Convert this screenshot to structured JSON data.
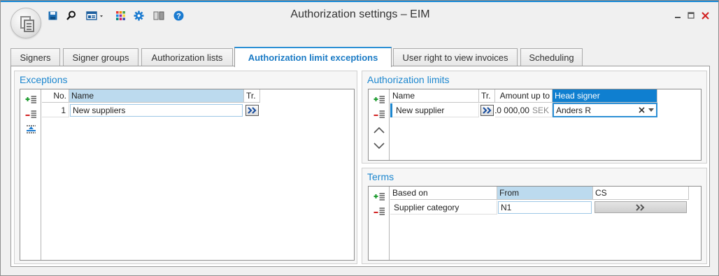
{
  "window": {
    "title": "Authorization settings – EIM"
  },
  "quick_access": {
    "icons": [
      "save-icon",
      "search-icon",
      "layout-icon",
      "grid-apps-icon",
      "gear-icon",
      "book-icon",
      "help-icon"
    ]
  },
  "tabs": [
    {
      "label": "Signers",
      "active": false
    },
    {
      "label": "Signer groups",
      "active": false
    },
    {
      "label": "Authorization lists",
      "active": false
    },
    {
      "label": "Authorization limit exceptions",
      "active": true
    },
    {
      "label": "User right to view invoices",
      "active": false
    },
    {
      "label": "Scheduling",
      "active": false
    }
  ],
  "exceptions": {
    "title": "Exceptions",
    "columns": {
      "no": "No.",
      "name": "Name",
      "tr": "Tr."
    },
    "rows": [
      {
        "no": "1",
        "name": "New suppliers"
      }
    ]
  },
  "authorization_limits": {
    "title": "Authorization limits",
    "columns": {
      "name": "Name",
      "tr": "Tr.",
      "amount": "Amount up to",
      "head_signer": "Head signer"
    },
    "rows": [
      {
        "name": "New supplier",
        "amount": "10 000,00",
        "currency": "SEK",
        "head_signer": "Anders R"
      }
    ]
  },
  "terms": {
    "title": "Terms",
    "columns": {
      "based_on": "Based on",
      "from": "From",
      "cs": "CS"
    },
    "rows": [
      {
        "based_on": "Supplier category",
        "from": "N1"
      }
    ]
  },
  "colors": {
    "accent": "#1d87cf",
    "selected_header": "#bcdaee",
    "active_header": "#0f7fd0",
    "close_red": "#d22020"
  }
}
